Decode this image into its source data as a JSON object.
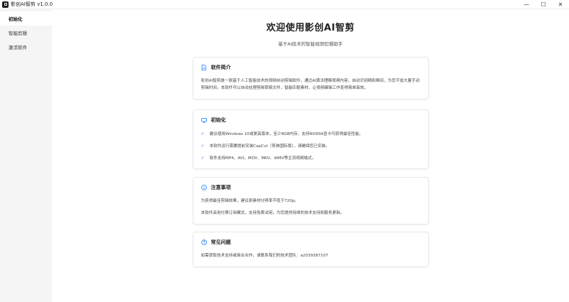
{
  "window": {
    "title": "影创AI智剪 v1.0.0",
    "controls": {
      "minimize": "—",
      "maximize": "☐",
      "close": "✕"
    }
  },
  "sidebar": {
    "items": [
      {
        "label": "初始化",
        "active": true
      },
      {
        "label": "智能剪辑",
        "active": false
      },
      {
        "label": "激活软件",
        "active": false
      }
    ]
  },
  "main": {
    "title": "欢迎使用影创AI智剪",
    "subtitle": "基于AI技术的智能视频剪辑助手",
    "cards": {
      "intro": {
        "title": "软件简介",
        "icon": "document-icon",
        "text": "影创AI智剪是一款基于人工智能技术的视频自动剪辑软件，通过AI算法理解视频内容，自动识别精彩瞬间，为您节省大量手动剪辑时间。本软件可以自动处理剪映草稿文件，智能匹配素材，让视频编辑工作变得简单高效。"
      },
      "init": {
        "title": "初始化",
        "icon": "monitor-icon",
        "items": [
          "建议使用Windows 10或更高版本，至少8GB内存，支持NVIDIA显卡可获得最佳性能。",
          "本软件运行需要提前安装CapCut（剪映国际版），请确保您已安装。",
          "软件支持MP4、AVI、MOV、MKV、WMV等主流视频格式。"
        ]
      },
      "notice": {
        "title": "注意事项",
        "icon": "info-icon",
        "line1": "为获得最佳剪辑效果，建议原素材分辨率不低于720p。",
        "line2": "本软件采用付费订阅模式，支持免费试用，为您提供持续的技术支持和服务更新。"
      },
      "faq": {
        "title": "常见问题",
        "icon": "help-icon",
        "text": "如需获取技术支持或商业合作，请联系我们的技术团队：a2039387107"
      }
    }
  },
  "colors": {
    "accent": "#1677ff",
    "sidebar_bg": "#f5f5f6"
  }
}
